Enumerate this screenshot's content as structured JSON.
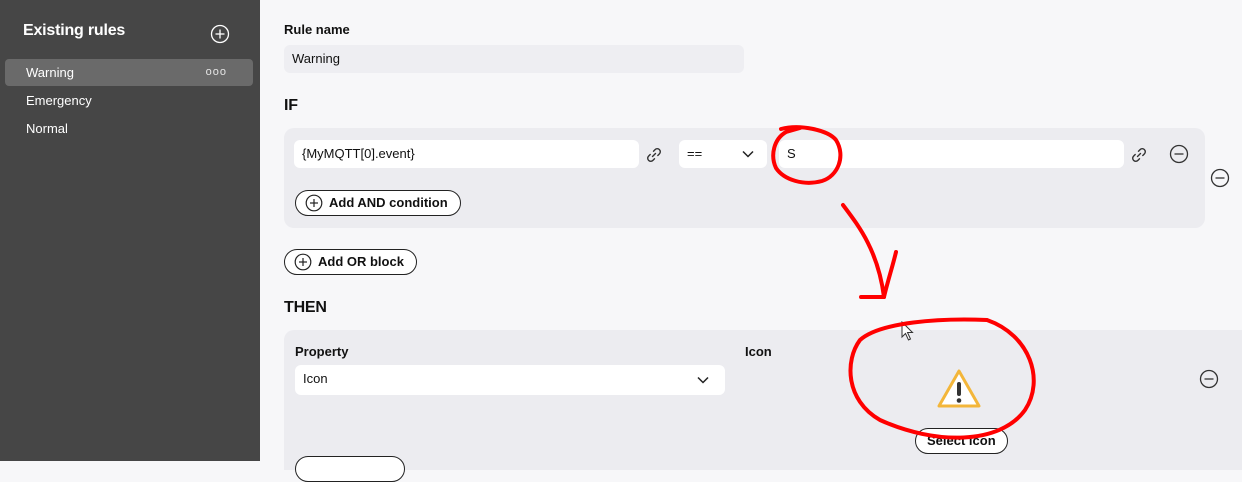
{
  "sidebar": {
    "title": "Existing rules",
    "items": [
      {
        "label": "Warning",
        "more": "ooo"
      },
      {
        "label": "Emergency"
      },
      {
        "label": "Normal"
      }
    ]
  },
  "editor": {
    "rule_name_label": "Rule name",
    "rule_name_value": "Warning",
    "if_heading": "IF",
    "condition": {
      "left_value": "{MyMQTT[0].event}",
      "operator": "==",
      "right_value": "S"
    },
    "add_and_label": "Add AND condition",
    "add_or_label": "Add OR block",
    "then_heading": "THEN",
    "property_label": "Property",
    "property_value": "Icon",
    "icon_label": "Icon",
    "select_icon_label": "Select icon"
  },
  "colors": {
    "sidebar_bg": "#464646",
    "annotation": "#ff0000",
    "warning_icon": "#f3b63a"
  },
  "icons": [
    "plus-circle-icon",
    "more-icon",
    "link-icon",
    "chevron-down-icon",
    "minus-circle-icon",
    "warning-icon",
    "cursor-icon"
  ]
}
